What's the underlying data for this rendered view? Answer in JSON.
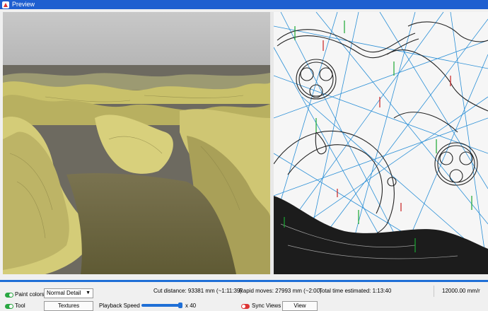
{
  "window": {
    "title": "Preview",
    "icon": "app-icon"
  },
  "controls": {
    "paint_colors_label": "Paint colors",
    "detail_select_value": "Normal Detail",
    "tool_label": "Tool",
    "textures_button": "Textures",
    "playback_speed_label": "Playback Speed",
    "playback_speed_value": "x 40",
    "sync_views_label": "Sync Views",
    "view_button": "View",
    "paint_colors_on": true,
    "tool_on": true,
    "sync_views_on": false
  },
  "stats": {
    "cut_distance": "Cut distance: 93381 mm (~1:11:39)",
    "rapid_moves": "Rapid moves: 27993 mm (~2:00)",
    "total_time": "Total time estimated: 1:13:40",
    "feed_rate": "12000.00 mm/r"
  },
  "playback_progress": 1.0,
  "colors": {
    "title_bar": "#1f5fd0",
    "progress": "#1f6fd6",
    "terrain": "#c9c16a",
    "rapid_lines": "#2a8fd6"
  }
}
